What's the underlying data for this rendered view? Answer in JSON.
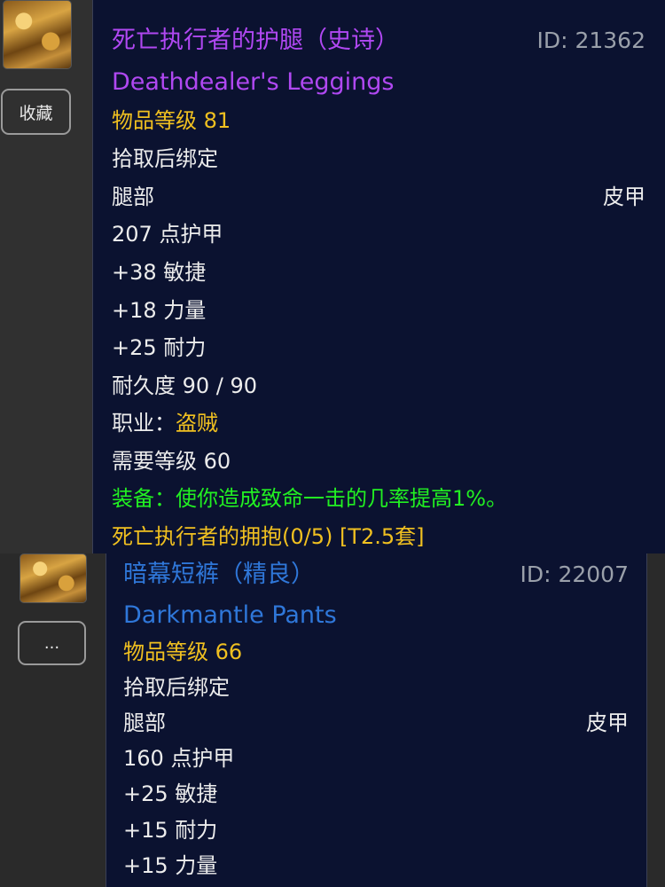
{
  "colors": {
    "epic": "#b048f2",
    "rare": "#2f77d9",
    "item_level": "#f0c020",
    "equip_effect": "#22f022",
    "set_name": "#f0c020",
    "tooltip_bg": "#0b1230"
  },
  "item1": {
    "icon": "leggings-icon",
    "button_label": "收藏",
    "name_cn": "死亡执行者的护腿（史诗）",
    "id_text": "ID: 21362",
    "name_en": "Deathdealer's Leggings",
    "item_level": "物品等级 81",
    "binding": "拾取后绑定",
    "slot": "腿部",
    "armor_type": "皮甲",
    "armor": "207 点护甲",
    "stats": [
      "+38 敏捷",
      "+18 力量",
      "+25 耐力"
    ],
    "durability": "耐久度 90 / 90",
    "class_label": "职业：",
    "class_value": "盗贼",
    "required_level": "需要等级 60",
    "equip_effect": "装备：使你造成致命一击的几率提高1%。",
    "set": "死亡执行者的拥抱(0/5) [T2.5套]"
  },
  "item2": {
    "icon": "pants-icon",
    "button_label": "...",
    "name_cn": "暗幕短裤（精良）",
    "id_text": "ID: 22007",
    "name_en": "Darkmantle Pants",
    "item_level": "物品等级 66",
    "binding": "拾取后绑定",
    "slot": "腿部",
    "armor_type": "皮甲",
    "armor": "160 点护甲",
    "stats": [
      "+25 敏捷",
      "+15 耐力",
      "+15 力量"
    ]
  }
}
